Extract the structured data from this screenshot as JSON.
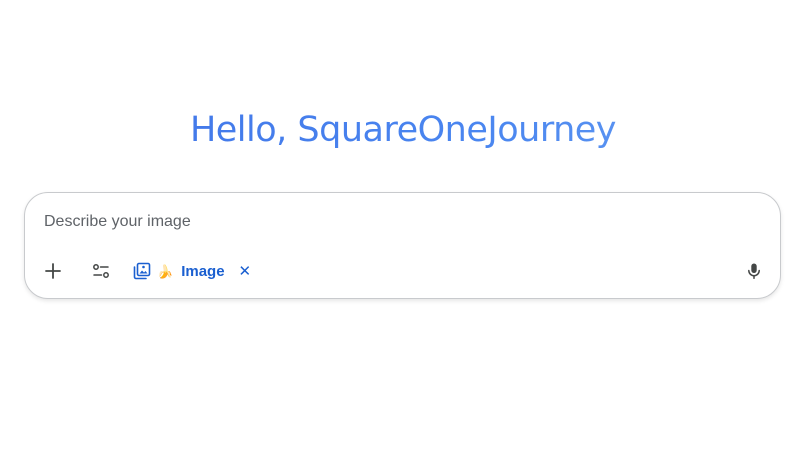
{
  "greeting": "Hello, SquareOneJourney",
  "prompt": {
    "placeholder": "Describe your image",
    "value": ""
  },
  "toolbar": {
    "add_icon": "plus-icon",
    "tools_icon": "tune-icon",
    "mic_icon": "mic-icon"
  },
  "chip": {
    "icon": "image-gallery-icon",
    "emoji": "🍌",
    "label": "Image",
    "close": "✕"
  },
  "colors": {
    "accent": "#1a5fd0",
    "greeting_start": "#3f72e6",
    "greeting_end": "#6aa0f2",
    "border": "#c8cacd"
  }
}
